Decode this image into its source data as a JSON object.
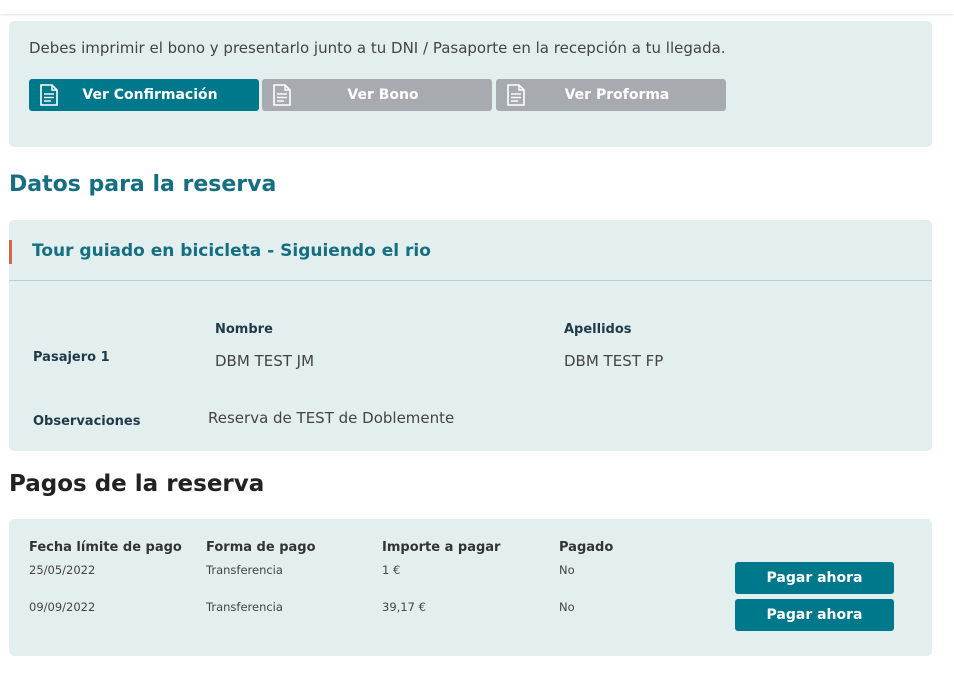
{
  "notice": {
    "text": "Debes imprimir el bono y presentarlo junto a tu DNI / Pasaporte en la recepción a tu llegada.",
    "buttons": [
      {
        "label": "Ver Confirmación",
        "icon": "document-icon",
        "active": true
      },
      {
        "label": "Ver Bono",
        "icon": "document-icon",
        "active": false
      },
      {
        "label": "Ver Proforma",
        "icon": "document-icon",
        "active": false
      }
    ]
  },
  "reservation": {
    "section_title": "Datos para la reserva",
    "activity_name": "Tour guiado en bicicleta - Siguiendo el rio",
    "name_header": "Nombre",
    "surname_header": "Apellidos",
    "passenger_label": "Pasajero 1",
    "passenger_name": "DBM TEST JM",
    "passenger_surname": "DBM TEST FP",
    "observations_label": "Observaciones",
    "observations_value": "Reserva de TEST de Doblemente"
  },
  "payments": {
    "section_title": "Pagos de la reserva",
    "headers": [
      "Fecha límite de pago",
      "Forma de pago",
      "Importe a pagar",
      "Pagado"
    ],
    "rows": [
      {
        "due_date": "25/05/2022",
        "method": "Transferencia",
        "amount": "1 €",
        "paid": "No",
        "button": "Pagar ahora"
      },
      {
        "due_date": "09/09/2022",
        "method": "Transferencia",
        "amount": "39,17 €",
        "paid": "No",
        "button": "Pagar ahora"
      }
    ]
  },
  "colors": {
    "teal": "#00788c",
    "gray_button": "#a7abaf",
    "card_bg": "#e3eeef",
    "accent_bar": "#d9654b"
  }
}
